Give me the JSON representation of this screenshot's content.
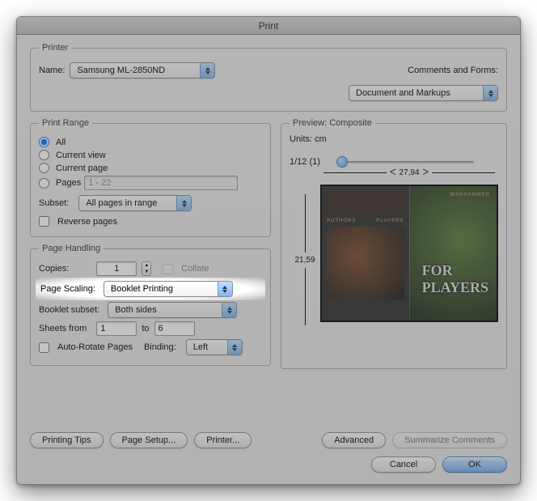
{
  "title": "Print",
  "printer": {
    "group_label": "Printer",
    "name_label": "Name:",
    "name_value": "Samsung ML-2850ND",
    "comments_label": "Comments and Forms:",
    "comments_value": "Document and Markups"
  },
  "range": {
    "group_label": "Print Range",
    "all": "All",
    "current_view": "Current view",
    "current_page": "Current page",
    "pages": "Pages",
    "pages_value": "1 - 22",
    "subset_label": "Subset:",
    "subset_value": "All pages in range",
    "reverse": "Reverse pages"
  },
  "handling": {
    "group_label": "Page Handling",
    "copies_label": "Copies:",
    "copies_value": "1",
    "collate": "Collate",
    "page_scaling_label": "Page Scaling:",
    "page_scaling_value": "Booklet Printing",
    "booklet_subset_label": "Booklet subset:",
    "booklet_subset_value": "Both sides",
    "sheets_from_label": "Sheets from",
    "sheets_from": "1",
    "sheets_to_label": "to",
    "sheets_to": "6",
    "auto_rotate": "Auto-Rotate Pages",
    "binding_label": "Binding:",
    "binding_value": "Left"
  },
  "preview": {
    "group_label": "Preview: Composite",
    "units": "Units: cm",
    "page_counter": "1/12 (1)",
    "width": "27,94",
    "height": "21,59",
    "right_caption1": "FOR",
    "right_caption2": "PLAYERS",
    "subcaption": "WARHAMMER",
    "left_tag1": "AUTHORS",
    "left_tag2": "PLAYERS"
  },
  "buttons": {
    "tips": "Printing Tips",
    "page_setup": "Page Setup...",
    "printer": "Printer...",
    "advanced": "Advanced",
    "summarize": "Summarize Comments",
    "cancel": "Cancel",
    "ok": "OK"
  }
}
